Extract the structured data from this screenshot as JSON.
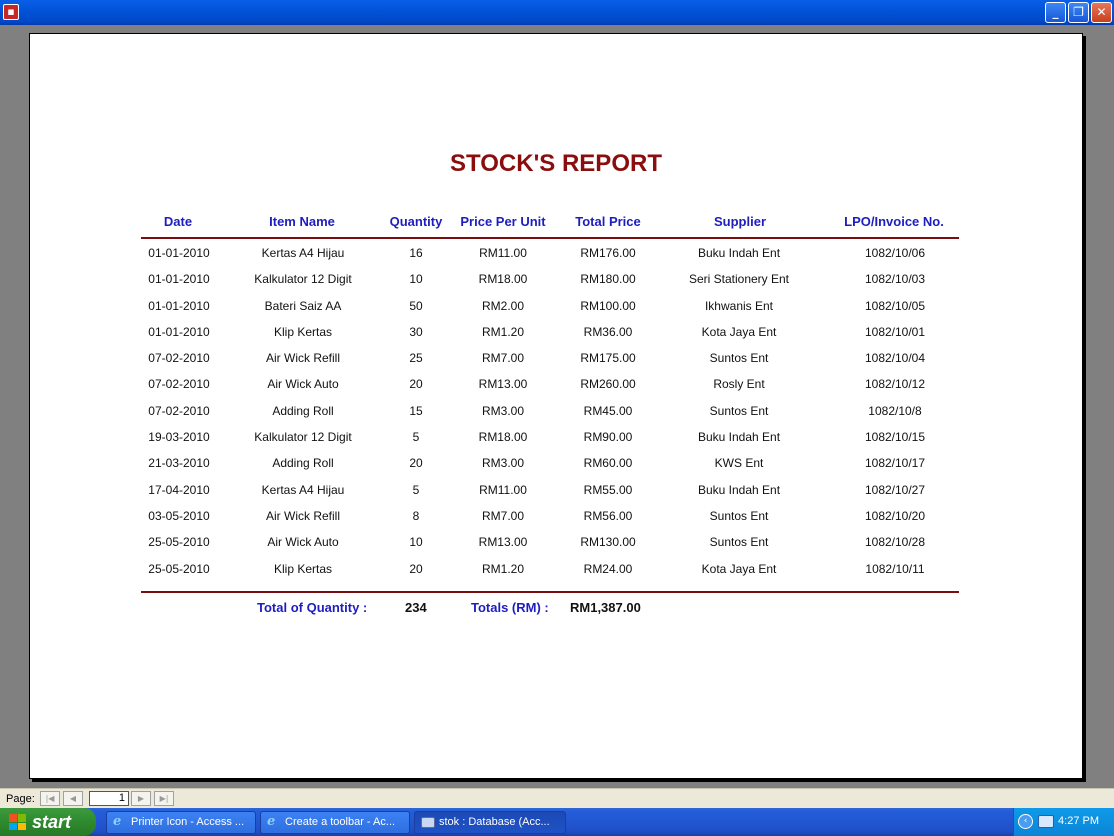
{
  "window": {
    "app_icon_glyph": "▪",
    "buttons": {
      "minimize": "_",
      "restore": "❐",
      "close": "✕"
    }
  },
  "report": {
    "title": "STOCK'S REPORT",
    "columns": [
      "Date",
      "Item Name",
      "Quantity",
      "Price Per Unit",
      "Total Price",
      "Supplier",
      "LPO/Invoice No."
    ],
    "rows": [
      [
        "01-01-2010",
        "Kertas A4 Hijau",
        "16",
        "RM11.00",
        "RM176.00",
        "Buku Indah Ent",
        "1082/10/06"
      ],
      [
        "01-01-2010",
        "Kalkulator 12 Digit",
        "10",
        "RM18.00",
        "RM180.00",
        "Seri Stationery Ent",
        "1082/10/03"
      ],
      [
        "01-01-2010",
        "Bateri Saiz AA",
        "50",
        "RM2.00",
        "RM100.00",
        "Ikhwanis Ent",
        "1082/10/05"
      ],
      [
        "01-01-2010",
        "Klip Kertas",
        "30",
        "RM1.20",
        "RM36.00",
        "Kota Jaya Ent",
        "1082/10/01"
      ],
      [
        "07-02-2010",
        "Air Wick Refill",
        "25",
        "RM7.00",
        "RM175.00",
        "Suntos Ent",
        "1082/10/04"
      ],
      [
        "07-02-2010",
        "Air Wick Auto",
        "20",
        "RM13.00",
        "RM260.00",
        "Rosly Ent",
        "1082/10/12"
      ],
      [
        "07-02-2010",
        "Adding Roll",
        "15",
        "RM3.00",
        "RM45.00",
        "Suntos Ent",
        "1082/10/8"
      ],
      [
        "19-03-2010",
        "Kalkulator 12 Digit",
        "5",
        "RM18.00",
        "RM90.00",
        "Buku Indah Ent",
        "1082/10/15"
      ],
      [
        "21-03-2010",
        "Adding Roll",
        "20",
        "RM3.00",
        "RM60.00",
        "KWS Ent",
        "1082/10/17"
      ],
      [
        "17-04-2010",
        "Kertas A4 Hijau",
        "5",
        "RM11.00",
        "RM55.00",
        "Buku Indah Ent",
        "1082/10/27"
      ],
      [
        "03-05-2010",
        "Air Wick Refill",
        "8",
        "RM7.00",
        "RM56.00",
        "Suntos Ent",
        "1082/10/20"
      ],
      [
        "25-05-2010",
        "Air Wick Auto",
        "10",
        "RM13.00",
        "RM130.00",
        "Suntos Ent",
        "1082/10/28"
      ],
      [
        "25-05-2010",
        "Klip Kertas",
        "20",
        "RM1.20",
        "RM24.00",
        "Kota Jaya Ent",
        "1082/10/11"
      ]
    ],
    "totals": {
      "quantity_label": "Total of Quantity :",
      "quantity_value": "234",
      "price_label": "Totals (RM) :",
      "price_value": "RM1,387.00"
    },
    "colors": {
      "title": "#8b0e0e",
      "header": "#1d1dc0",
      "rule": "#7a0e0e"
    }
  },
  "navigation": {
    "label": "Page:",
    "first": "|◀",
    "prev": "◀",
    "page_value": "1",
    "next": "▶",
    "last": "▶|"
  },
  "taskbar": {
    "start_label": "start",
    "items": [
      {
        "label": "Printer Icon - Access ...",
        "icon": "ie-icon"
      },
      {
        "label": "Create a toolbar - Ac...",
        "icon": "ie-icon"
      },
      {
        "label": "stok : Database (Acc...",
        "icon": "database-icon"
      }
    ],
    "tray_arrow": "‹",
    "clock": "4:27 PM"
  }
}
